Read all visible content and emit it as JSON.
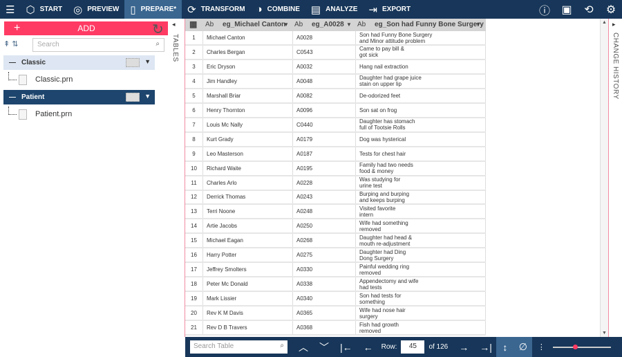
{
  "nav": {
    "items": [
      {
        "label": "START",
        "icon": "cube-icon"
      },
      {
        "label": "PREVIEW",
        "icon": "eye-icon"
      },
      {
        "label": "PREPARE*",
        "icon": "columns-icon",
        "active": true
      },
      {
        "label": "TRANSFORM",
        "icon": "transform-icon"
      },
      {
        "label": "COMBINE",
        "icon": "combine-icon"
      },
      {
        "label": "ANALYZE",
        "icon": "clipboard-icon"
      },
      {
        "label": "EXPORT",
        "icon": "export-icon"
      }
    ]
  },
  "sidebar": {
    "add_label": "ADD",
    "search_placeholder": "Search",
    "groups": [
      {
        "name": "Classic",
        "file": "Classic.prn",
        "selected": false
      },
      {
        "name": "Patient",
        "file": "Patient.prn",
        "selected": true
      }
    ]
  },
  "tables_label": "TABLES",
  "change_history_label": "CHANGE HISTORY",
  "grid": {
    "columns": [
      {
        "type": "Ab",
        "name": "eg_Michael Canton"
      },
      {
        "type": "Ab",
        "name": "eg_A0028"
      },
      {
        "type": "Ab",
        "name": "eg_Son had Funny Bone Surgery"
      }
    ],
    "rows": [
      [
        "1",
        "Michael Canton",
        "A0028",
        "Son had Funny Bone Surgery\nand Minor attitude problem"
      ],
      [
        "2",
        "Charles Bergan",
        "C0543",
        "Came to pay bill &\ngot sick"
      ],
      [
        "3",
        "Eric Dryson",
        "A0032",
        "Hang nail extraction"
      ],
      [
        "4",
        "Jim Handley",
        "A0048",
        "Daughter had grape juice\nstain on upper lip"
      ],
      [
        "5",
        "Marshall Briar",
        "A0082",
        "De-odorized feet"
      ],
      [
        "6",
        "Henry Thornton",
        "A0096",
        "Son sat on frog"
      ],
      [
        "7",
        "Louis Mc Nally",
        "C0440",
        "Daughter has stomach\nfull of Tootsie Rolls"
      ],
      [
        "8",
        "Kurt Grady",
        "A0179",
        "Dog was hysterical"
      ],
      [
        "9",
        "Leo Masterson",
        "A0187",
        "Tests for chest hair"
      ],
      [
        "10",
        "Richard Waite",
        "A0195",
        "Family had two needs\nfood & money"
      ],
      [
        "11",
        "Charles Arlo",
        "A0228",
        "Was studying for\nurine test"
      ],
      [
        "12",
        "Derrick Thomas",
        "A0243",
        "Burping and burping\nand keeps burping"
      ],
      [
        "13",
        "Terri Noone",
        "A0248",
        "Visited favorite\nintern"
      ],
      [
        "14",
        "Artie Jacobs",
        "A0250",
        "Wife had something\nremoved"
      ],
      [
        "15",
        "Michael Eagan",
        "A0268",
        "Daughter had head &\nmouth re-adjustment"
      ],
      [
        "16",
        "Harry Potter",
        "A0275",
        "Daughter had Ding\nDong Surgery"
      ],
      [
        "17",
        "Jeffrey Smolters",
        "A0330",
        "Painful wedding ring\nremoved"
      ],
      [
        "18",
        "Peter Mc Donald",
        "A0338",
        "Appendectomy and wife\nhad tests"
      ],
      [
        "19",
        "Mark Lissier",
        "A0340",
        "Son had tests for\nsomething"
      ],
      [
        "20",
        "Rev K M Davis",
        "A0365",
        "Wife had nose hair\nsurgery"
      ],
      [
        "21",
        "Rev D B Travers",
        "A0368",
        "Fish had growth\nremoved"
      ]
    ]
  },
  "footer": {
    "search_placeholder": "Search Table",
    "row_label": "Row:",
    "row_value": "45",
    "of_label": "of 126",
    "zoom_level": 0.35
  },
  "colors": {
    "topbar": "#173659",
    "accent": "#ff3b64",
    "active": "#3a6690"
  }
}
